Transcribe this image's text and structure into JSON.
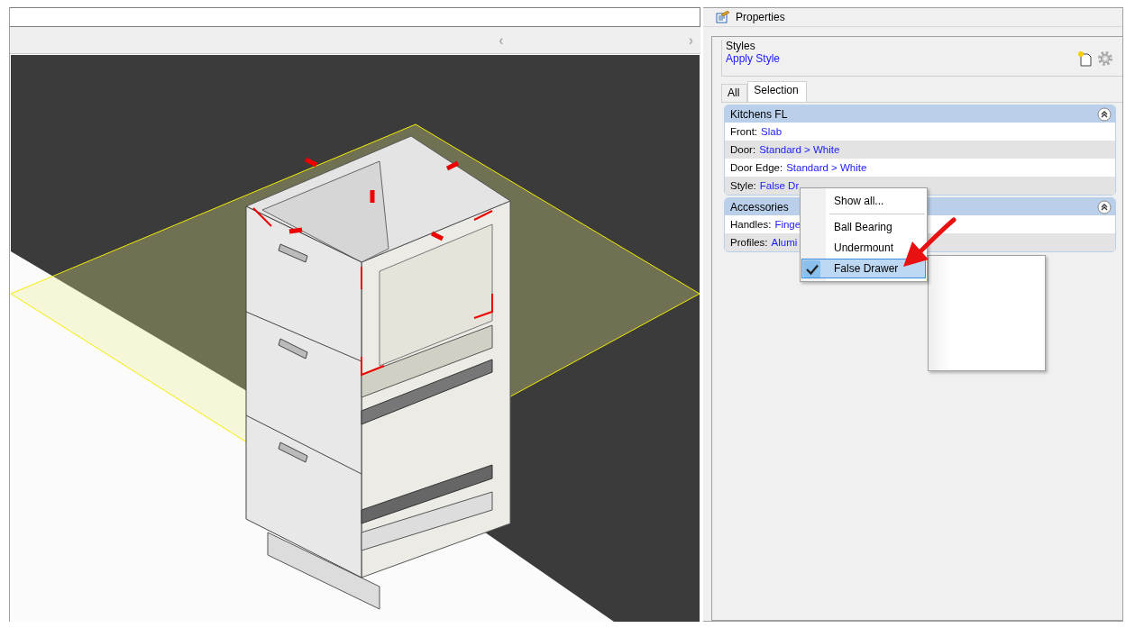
{
  "viewport": {
    "scroll_left": "‹",
    "scroll_right": "›"
  },
  "properties": {
    "title": "Properties",
    "styles": {
      "legend": "Styles",
      "link": "Apply Style"
    },
    "tabs": [
      {
        "label": "All",
        "selected": false
      },
      {
        "label": "Selection",
        "selected": true
      }
    ],
    "groups": [
      {
        "title": "Kitchens FL",
        "expanded": true,
        "rows": [
          {
            "label": "Front:",
            "value": "Slab"
          },
          {
            "label": "Door:",
            "value": "Standard > White"
          },
          {
            "label": "Door Edge:",
            "value": "Standard > White"
          },
          {
            "label": "Style:",
            "value": "False Dr"
          }
        ]
      },
      {
        "title": "Accessories",
        "expanded": true,
        "rows": [
          {
            "label": "Handles:",
            "value": "Finge"
          },
          {
            "label": "Profiles:",
            "value": "Alumi"
          }
        ]
      }
    ]
  },
  "context_menu": {
    "items": [
      {
        "kind": "item",
        "label": "Show all...",
        "checked": false,
        "selected": false
      },
      {
        "kind": "separator"
      },
      {
        "kind": "item",
        "label": "Ball Bearing",
        "checked": false,
        "selected": false
      },
      {
        "kind": "item",
        "label": "Undermount",
        "checked": false,
        "selected": false
      },
      {
        "kind": "item",
        "label": "False Drawer",
        "checked": true,
        "selected": true
      }
    ]
  }
}
